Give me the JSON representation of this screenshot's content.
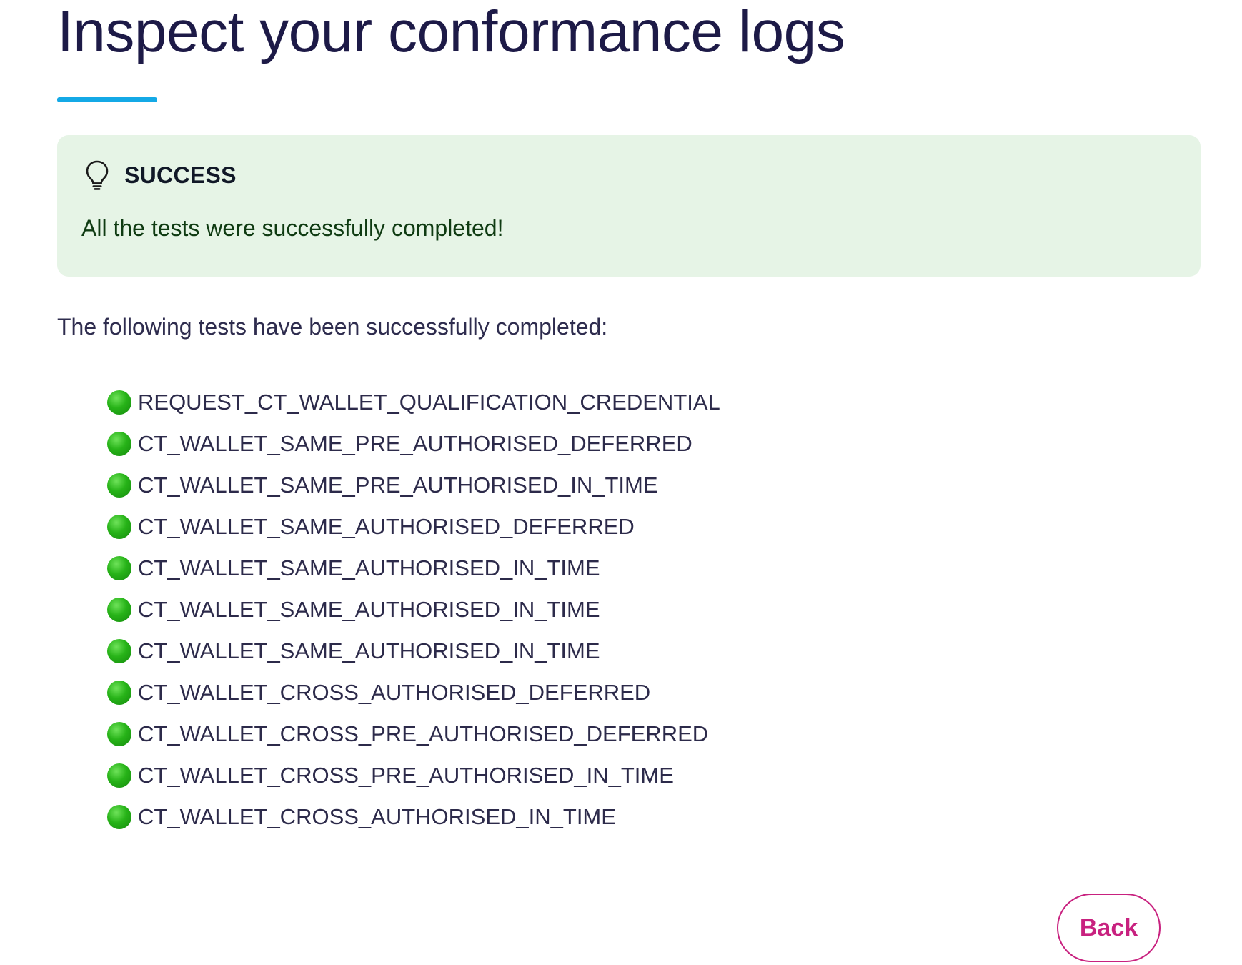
{
  "page": {
    "title": "Inspect your conformance logs"
  },
  "alert": {
    "icon": "lightbulb-icon",
    "title": "SUCCESS",
    "message": "All the tests were successfully completed!",
    "background_color": "#e6f4e6"
  },
  "intro_text": "The following tests have been successfully completed:",
  "tests": [
    {
      "status": "passed",
      "status_icon": "green-circle",
      "name": "REQUEST_CT_WALLET_QUALIFICATION_CREDENTIAL"
    },
    {
      "status": "passed",
      "status_icon": "green-circle",
      "name": "CT_WALLET_SAME_PRE_AUTHORISED_DEFERRED"
    },
    {
      "status": "passed",
      "status_icon": "green-circle",
      "name": "CT_WALLET_SAME_PRE_AUTHORISED_IN_TIME"
    },
    {
      "status": "passed",
      "status_icon": "green-circle",
      "name": "CT_WALLET_SAME_AUTHORISED_DEFERRED"
    },
    {
      "status": "passed",
      "status_icon": "green-circle",
      "name": "CT_WALLET_SAME_AUTHORISED_IN_TIME"
    },
    {
      "status": "passed",
      "status_icon": "green-circle",
      "name": "CT_WALLET_SAME_AUTHORISED_IN_TIME"
    },
    {
      "status": "passed",
      "status_icon": "green-circle",
      "name": "CT_WALLET_SAME_AUTHORISED_IN_TIME"
    },
    {
      "status": "passed",
      "status_icon": "green-circle",
      "name": "CT_WALLET_CROSS_AUTHORISED_DEFERRED"
    },
    {
      "status": "passed",
      "status_icon": "green-circle",
      "name": "CT_WALLET_CROSS_PRE_AUTHORISED_DEFERRED"
    },
    {
      "status": "passed",
      "status_icon": "green-circle",
      "name": "CT_WALLET_CROSS_PRE_AUTHORISED_IN_TIME"
    },
    {
      "status": "passed",
      "status_icon": "green-circle",
      "name": "CT_WALLET_CROSS_AUTHORISED_IN_TIME"
    }
  ],
  "actions": {
    "back_label": "Back"
  },
  "colors": {
    "title": "#1d1a47",
    "accent_underline": "#14a9e6",
    "success_dot": "#27b318",
    "back_button": "#c8217f"
  }
}
